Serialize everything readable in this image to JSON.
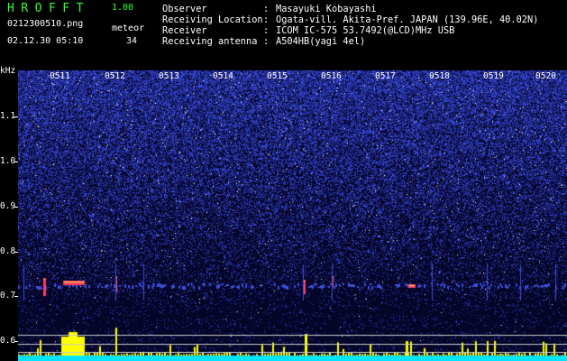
{
  "app": {
    "title": "HROFFT",
    "version": "1.00"
  },
  "file": {
    "name": "0212300510.png",
    "datetime": "02.12.30 05:10"
  },
  "meteor": {
    "label": "meteor",
    "count": "34"
  },
  "info": [
    {
      "label": "Observer",
      "value": "Masayuki Kobayashi"
    },
    {
      "label": "Receiving Location",
      "value": "Ogata-vill. Akita-Pref. JAPAN (139.96E, 40.02N)"
    },
    {
      "label": "Receiver",
      "value": "ICOM IC-575 53.7492(@LCD)MHz USB"
    },
    {
      "label": "Receiving antenna",
      "value": "A504HB(yagi 4el)"
    }
  ],
  "separator": ":",
  "y_axis": {
    "unit": "kHz",
    "ticks": [
      "1.1",
      "1.0",
      "0.9",
      "0.8",
      "0.7",
      "0.6"
    ]
  },
  "time_axis": {
    "ticks": [
      "0511",
      "0512",
      "0513",
      "0514",
      "0515",
      "0516",
      "0517",
      "0518",
      "0519",
      "0520"
    ]
  },
  "colors": {
    "background": "#000000",
    "plot_background": "#050528",
    "title": "#33ff33",
    "text": "#ffffff",
    "noise": "#3c50dc",
    "echo_hot": "#ff3c64",
    "echo_warm": "#ffdc3c",
    "activity": "#ffff00",
    "baseline": "#00e5ff"
  }
}
